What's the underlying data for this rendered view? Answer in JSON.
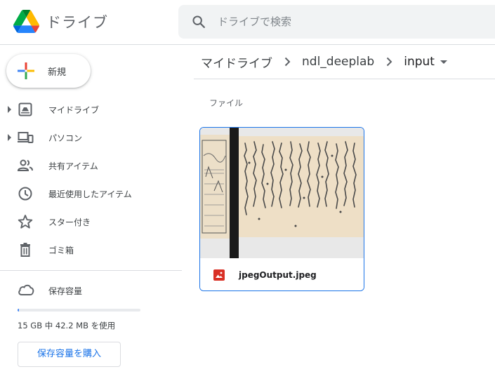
{
  "header": {
    "app_title": "ドライブ",
    "search_placeholder": "ドライブで検索"
  },
  "sidebar": {
    "new_label": "新規",
    "items": [
      {
        "label": "マイドライブ",
        "icon": "my-drive-icon",
        "expandable": true
      },
      {
        "label": "パソコン",
        "icon": "computers-icon",
        "expandable": true
      },
      {
        "label": "共有アイテム",
        "icon": "shared-icon",
        "expandable": false
      },
      {
        "label": "最近使用したアイテム",
        "icon": "recent-icon",
        "expandable": false
      },
      {
        "label": "スター付き",
        "icon": "star-icon",
        "expandable": false
      },
      {
        "label": "ゴミ箱",
        "icon": "trash-icon",
        "expandable": false
      }
    ],
    "storage": {
      "label": "保存容量",
      "usage_text": "15 GB 中 42.2 MB を使用",
      "used_fraction": 0.0028,
      "buy_label": "保存容量を購入"
    }
  },
  "main": {
    "breadcrumb": [
      "マイドライブ",
      "ndl_deeplab",
      "input"
    ],
    "section_label": "ファイル",
    "files": [
      {
        "name": "jpegOutput.jpeg",
        "type_icon": "image-file-icon"
      }
    ]
  },
  "colors": {
    "accent": "#1a73e8",
    "divider": "#dadce0",
    "search_bg": "#f1f3f4",
    "image_icon": "#d93025"
  }
}
